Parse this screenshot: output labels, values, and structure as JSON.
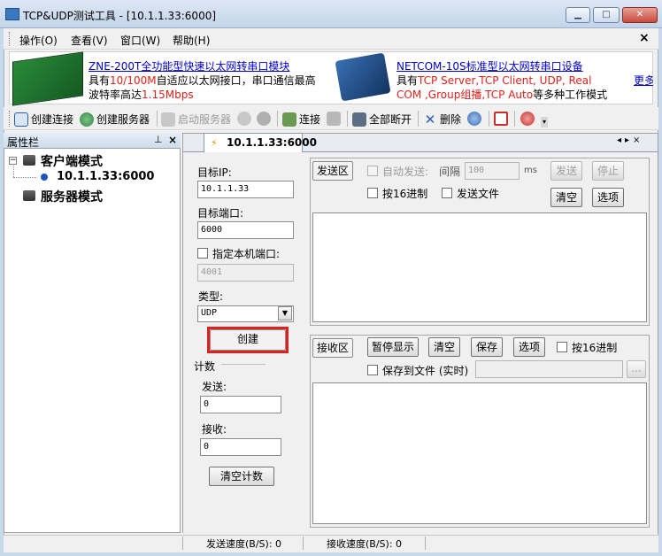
{
  "window": {
    "title": "TCP&UDP测试工具 - [10.1.1.33:6000]",
    "close_glyph": "✕",
    "min_glyph": "▁",
    "max_glyph": "□"
  },
  "menu": {
    "items": [
      "操作(O)",
      "查看(V)",
      "窗口(W)",
      "帮助(H)"
    ],
    "close_glyph": "×"
  },
  "banner": {
    "ad1": {
      "title": "ZNE-200T全功能型快速以太网转串口模块",
      "line2_pre": "具有",
      "line2_red": "10/100M",
      "line2_post": "自适应以太网接口，串口通信最高",
      "line3_pre": "波特率高达",
      "line3_red": "1.15Mbps"
    },
    "ad2": {
      "title": "NETCOM-10S标准型以太网转串口设备",
      "line2_pre": "具有",
      "line2_red": "TCP Server,TCP Client, UDP, Real",
      "line3_red": "COM ,Group组播,TCP Auto",
      "line3_post": "等多种工作模式"
    },
    "ad3_title": "更多"
  },
  "toolbar": {
    "create_connection": "创建连接",
    "create_server": "创建服务器",
    "start_server": "启动服务器",
    "connect": "连接",
    "disconnect_all": "全部断开",
    "delete": "删除",
    "colors": {
      "blue": "#2a5db0",
      "green": "#2e8b3e",
      "red": "#c8302a",
      "gray": "#9a9a9a",
      "orange": "#d9821e"
    }
  },
  "sidebar": {
    "title": "属性栏",
    "pin_glyph": "⊥",
    "close_glyph": "×",
    "tree": {
      "client_mode": "客户端模式",
      "client_child": "10.1.1.33:6000",
      "server_mode": "服务器模式",
      "expand_glyph": "−"
    }
  },
  "tab": {
    "label": "10.1.1.33:6000",
    "icon_glyph": "⚡",
    "nav": "◂▸×"
  },
  "form": {
    "target_ip_label": "目标IP:",
    "target_ip_value": "10.1.1.33",
    "target_port_label": "目标端口:",
    "target_port_value": "6000",
    "local_port_label": "指定本机端口:",
    "local_port_value": "4001",
    "type_label": "类型:",
    "type_value": "UDP",
    "create_button": "创建",
    "count_label": "计数",
    "send_label": "发送:",
    "send_value": "0",
    "recv_label": "接收:",
    "recv_value": "0",
    "clear_count_button": "清空计数"
  },
  "send": {
    "area_button": "发送区",
    "auto_send": "自动发送:",
    "interval_label": "间隔",
    "interval_value": "100",
    "interval_unit": "ms",
    "send_button": "发送",
    "stop_button": "停止",
    "hex_label": "按16进制",
    "send_file_label": "发送文件",
    "clear_button": "清空",
    "options_button": "选项"
  },
  "recv": {
    "area_button": "接收区",
    "pause_button": "暂停显示",
    "clear_button": "清空",
    "save_button": "保存",
    "options_button": "选项",
    "hex_label": "按16进制",
    "save_file_label": "保存到文件 (实时)",
    "browse_button": "..."
  },
  "status": {
    "send_speed": "发送速度(B/S): 0",
    "recv_speed": "接收速度(B/S): 0"
  }
}
